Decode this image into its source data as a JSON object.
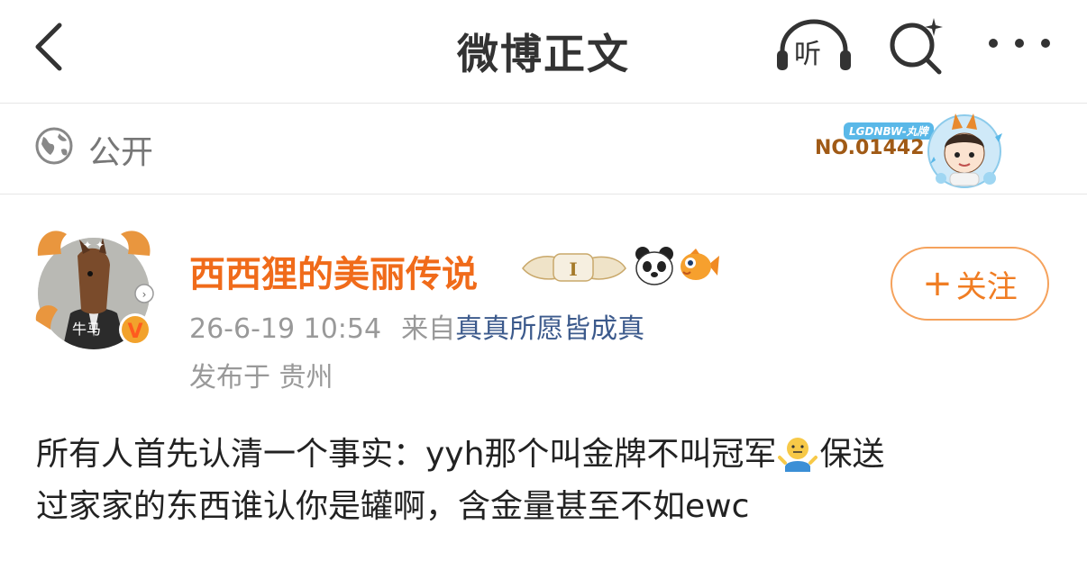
{
  "header": {
    "title": "微博正文",
    "listen_label": "听"
  },
  "visibility": {
    "label": "公开"
  },
  "badge": {
    "tag": "LGDNBW-丸牌",
    "number": "NO.01442"
  },
  "user": {
    "name": "西西狸的美丽传说",
    "avatar_caption": "牛马",
    "follow_label": "关注",
    "follow_plus": "+"
  },
  "meta": {
    "time": "26-6-19 10:54",
    "source_prefix": "来自",
    "source": "真真所愿皆成真",
    "location": "发布于 贵州"
  },
  "post": {
    "line1_a": "所有人首先认清一个事实：yyh那个叫金牌不叫冠军",
    "line1_b": "保送",
    "line2": "过家家的东西谁认你是罐啊，含金量甚至不如ewc"
  },
  "colors": {
    "username": "#f06b1a",
    "follow": "#f07d23",
    "source_link": "#3c5a8c",
    "meta_gray": "#999999"
  }
}
